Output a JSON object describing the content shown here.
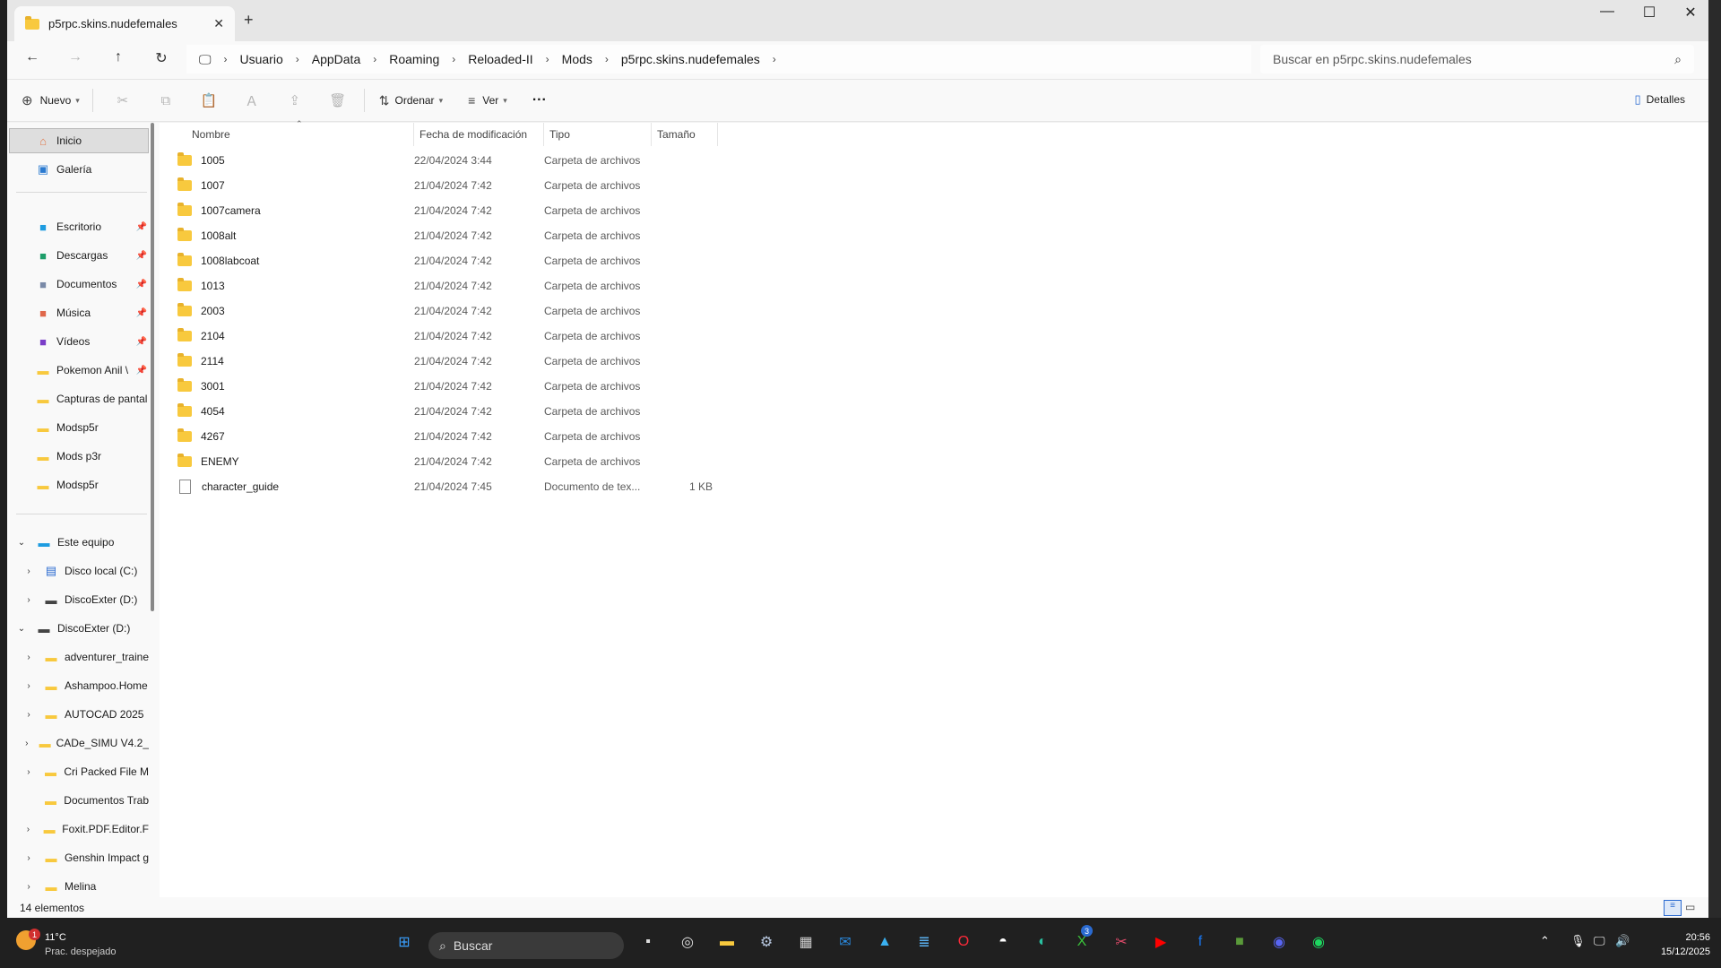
{
  "window": {
    "tab_title": "p5rpc.skins.nudefemales",
    "new_tab": "+",
    "close_tab": "✕",
    "minimize": "—",
    "maximize": "☐",
    "close": "✕"
  },
  "nav": {
    "breadcrumb": [
      "Usuario",
      "AppData",
      "Roaming",
      "Reloaded-II",
      "Mods",
      "p5rpc.skins.nudefemales"
    ],
    "search_placeholder": "Buscar en p5rpc.skins.nudefemales"
  },
  "toolbar": {
    "new_label": "Nuevo",
    "sort_label": "Ordenar",
    "view_label": "Ver",
    "more_label": "···",
    "details_label": "Detalles"
  },
  "sidebar": {
    "home": "Inicio",
    "gallery": "Galería",
    "pinned": [
      {
        "label": "Escritorio",
        "icon": "desktop-icon",
        "color": "#1e9ce0"
      },
      {
        "label": "Descargas",
        "icon": "download-icon",
        "color": "#1e9e6a"
      },
      {
        "label": "Documentos",
        "icon": "documents-icon",
        "color": "#7a8aa8"
      },
      {
        "label": "Música",
        "icon": "music-icon",
        "color": "#e0684b"
      },
      {
        "label": "Vídeos",
        "icon": "video-icon",
        "color": "#7a3ec8"
      },
      {
        "label": "Pokemon Anil \\",
        "icon": "folder-icon",
        "color": "#f8c93e"
      },
      {
        "label": "Capturas de pantal",
        "icon": "folder-icon",
        "color": "#f8c93e"
      },
      {
        "label": "Modsp5r",
        "icon": "folder-icon",
        "color": "#f8c93e"
      },
      {
        "label": "Mods p3r",
        "icon": "folder-icon",
        "color": "#f8c93e"
      },
      {
        "label": "Modsp5r",
        "icon": "folder-icon",
        "color": "#f8c93e"
      }
    ],
    "this_pc": "Este equipo",
    "this_pc_children": [
      "Disco local (C:)",
      "DiscoExter (D:)"
    ],
    "drive": "DiscoExter (D:)",
    "drive_children": [
      "adventurer_traine",
      "Ashampoo.Home",
      "AUTOCAD 2025",
      "CADe_SIMU V4.2_",
      "Cri Packed File M",
      "Documentos Trab",
      "Foxit.PDF.Editor.F",
      "Genshin Impact g",
      "Melina"
    ]
  },
  "columns": {
    "name": "Nombre",
    "modified": "Fecha de modificación",
    "type": "Tipo",
    "size": "Tamaño"
  },
  "files": [
    {
      "name": "1005",
      "date": "22/04/2024 3:44",
      "type": "Carpeta de archivos",
      "size": ""
    },
    {
      "name": "1007",
      "date": "21/04/2024 7:42",
      "type": "Carpeta de archivos",
      "size": ""
    },
    {
      "name": "1007camera",
      "date": "21/04/2024 7:42",
      "type": "Carpeta de archivos",
      "size": ""
    },
    {
      "name": "1008alt",
      "date": "21/04/2024 7:42",
      "type": "Carpeta de archivos",
      "size": ""
    },
    {
      "name": "1008labcoat",
      "date": "21/04/2024 7:42",
      "type": "Carpeta de archivos",
      "size": ""
    },
    {
      "name": "1013",
      "date": "21/04/2024 7:42",
      "type": "Carpeta de archivos",
      "size": ""
    },
    {
      "name": "2003",
      "date": "21/04/2024 7:42",
      "type": "Carpeta de archivos",
      "size": ""
    },
    {
      "name": "2104",
      "date": "21/04/2024 7:42",
      "type": "Carpeta de archivos",
      "size": ""
    },
    {
      "name": "2114",
      "date": "21/04/2024 7:42",
      "type": "Carpeta de archivos",
      "size": ""
    },
    {
      "name": "3001",
      "date": "21/04/2024 7:42",
      "type": "Carpeta de archivos",
      "size": ""
    },
    {
      "name": "4054",
      "date": "21/04/2024 7:42",
      "type": "Carpeta de archivos",
      "size": ""
    },
    {
      "name": "4267",
      "date": "21/04/2024 7:42",
      "type": "Carpeta de archivos",
      "size": ""
    },
    {
      "name": "ENEMY",
      "date": "21/04/2024 7:42",
      "type": "Carpeta de archivos",
      "size": ""
    },
    {
      "name": "character_guide",
      "date": "21/04/2024 7:45",
      "type": "Documento de tex...",
      "size": "1 KB",
      "is_file": true
    }
  ],
  "status": {
    "item_count": "14 elementos"
  },
  "taskbar": {
    "weather_temp": "11°C",
    "weather_desc": "Prac. despejado",
    "weather_badge": "1",
    "search_placeholder": "Buscar",
    "xbox_badge": "3",
    "time": "20:56",
    "date": "15/12/2025",
    "apps": [
      {
        "name": "start-icon",
        "glyph": "⊞",
        "color": "#3aa0ff"
      },
      {
        "name": "task-view-icon",
        "glyph": "▪",
        "color": "#dddddd"
      },
      {
        "name": "ubisoft-icon",
        "glyph": "◎",
        "color": "#dddddd"
      },
      {
        "name": "file-explorer-icon",
        "glyph": "▬",
        "color": "#f8c93e"
      },
      {
        "name": "settings-icon",
        "glyph": "⚙",
        "color": "#b8c8e0"
      },
      {
        "name": "calculator-icon",
        "glyph": "▦",
        "color": "#d0d0d0"
      },
      {
        "name": "outlook-icon",
        "glyph": "✉",
        "color": "#2a8ae0"
      },
      {
        "name": "photos-icon",
        "glyph": "▲",
        "color": "#3ab0f0"
      },
      {
        "name": "notepad-icon",
        "glyph": "≣",
        "color": "#5ab0f0"
      },
      {
        "name": "opera-icon",
        "glyph": "O",
        "color": "#ff2a3a"
      },
      {
        "name": "pokeball-icon",
        "glyph": "◓",
        "color": "#ffffff"
      },
      {
        "name": "edge-icon",
        "glyph": "◐",
        "color": "#2ac0a0"
      },
      {
        "name": "xbox-icon",
        "glyph": "X",
        "color": "#3ac03a"
      },
      {
        "name": "snipping-tool-icon",
        "glyph": "✂",
        "color": "#e04a6a"
      },
      {
        "name": "youtube-icon",
        "glyph": "▶",
        "color": "#ff0000"
      },
      {
        "name": "facebook-icon",
        "glyph": "f",
        "color": "#1877f2"
      },
      {
        "name": "minecraft-icon",
        "glyph": "■",
        "color": "#5a9a3a"
      },
      {
        "name": "discord-icon",
        "glyph": "◉",
        "color": "#5865f2"
      },
      {
        "name": "spotify-icon",
        "glyph": "◉",
        "color": "#1ed760"
      }
    ]
  }
}
